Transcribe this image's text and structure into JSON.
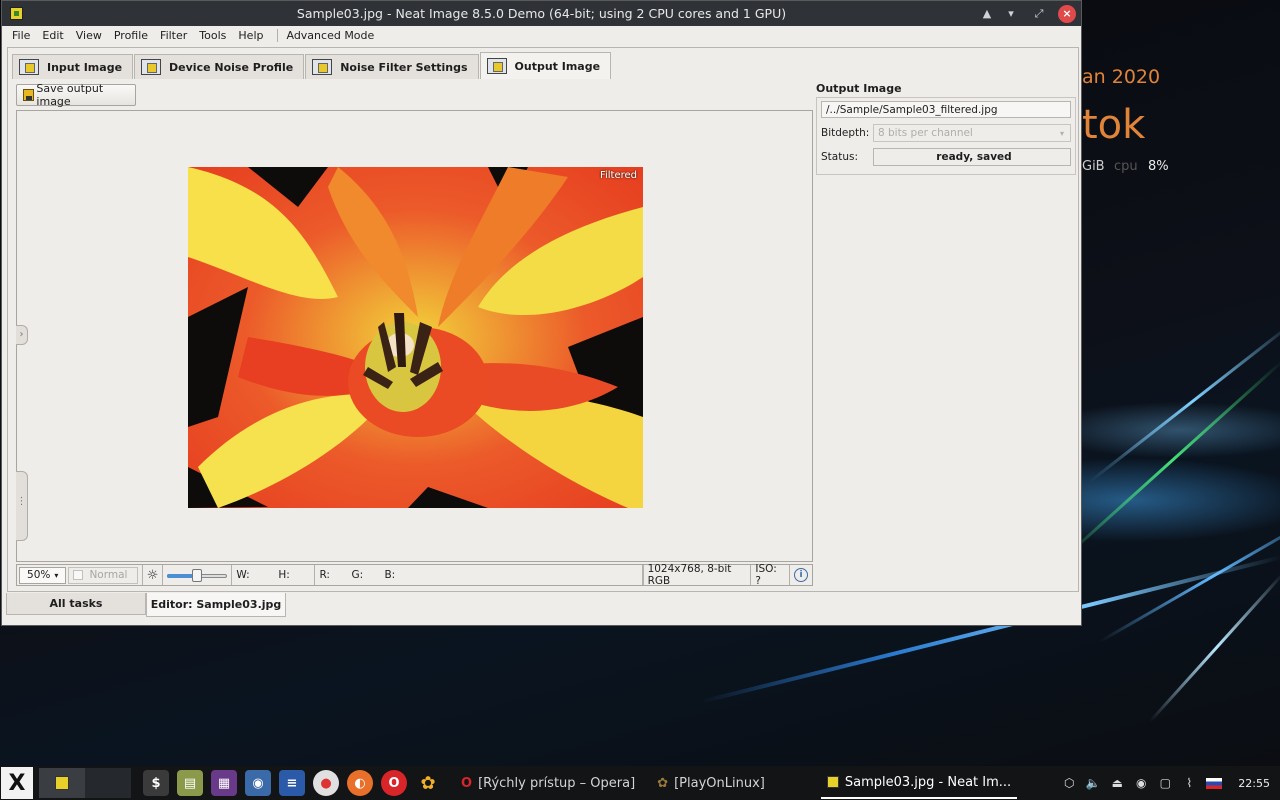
{
  "window": {
    "title": "Sample03.jpg - Neat Image 8.5.0 Demo (64-bit; using 2 CPU cores and 1 GPU)"
  },
  "menu": {
    "items": [
      "File",
      "Edit",
      "View",
      "Profile",
      "Filter",
      "Tools",
      "Help"
    ],
    "advanced": "Advanced Mode"
  },
  "tabs": [
    {
      "label": "Input Image"
    },
    {
      "label": "Device Noise Profile"
    },
    {
      "label": "Noise Filter Settings"
    },
    {
      "label": "Output Image"
    }
  ],
  "toolbar": {
    "save_label": "Save output image"
  },
  "viewer": {
    "overlay_label": "Filtered"
  },
  "statusbar": {
    "zoom": "50%",
    "mode": "Normal",
    "w_label": "W:",
    "h_label": "H:",
    "r_label": "R:",
    "g_label": "G:",
    "b_label": "B:",
    "image_info": "1024x768, 8-bit RGB",
    "iso": "ISO: ?",
    "brightness_level": 0.5
  },
  "output_panel": {
    "title": "Output Image",
    "path": "/../Sample/Sample03_filtered.jpg",
    "bitdepth_label": "Bitdepth:",
    "bitdepth_value": "8 bits per channel",
    "status_label": "Status:",
    "status_value": "ready, saved"
  },
  "bottom_tabs": [
    {
      "label": "All tasks"
    },
    {
      "label": "Editor: Sample03.jpg"
    }
  ],
  "desktop_widget": {
    "date_fragment": "an 2020",
    "day_fragment": "tok",
    "mem_fragment": "GiB",
    "cpu_label": "cpu",
    "cpu_value": "8%"
  },
  "taskbar": {
    "tasks": [
      {
        "label": "[Rýchly prístup – Opera]"
      },
      {
        "label": "[PlayOnLinux]"
      },
      {
        "label": "Sample03.jpg - Neat Im..."
      }
    ],
    "clock": "22:55"
  },
  "colors": {
    "accent": "#4b8ed6",
    "titlebar": "#2f3338",
    "close": "#e04a4a",
    "desktop_text": "#e0843a"
  }
}
